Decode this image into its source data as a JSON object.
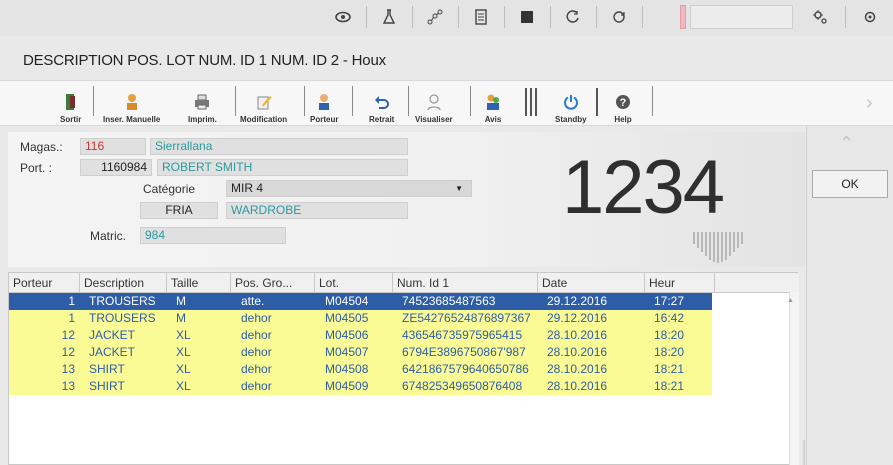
{
  "system_bar": {
    "icons": [
      "eye-icon",
      "flask-icon",
      "network-icon",
      "document-icon",
      "square-icon",
      "refresh-icon",
      "sync-icon",
      "gear-icon",
      "record-icon"
    ]
  },
  "window": {
    "title": "DESCRIPTION POS. LOT NUM. ID 1 NUM. ID 2 - Houx"
  },
  "toolbar": {
    "sortir": "Sortir",
    "inser_manuelle": "Inser. Manuelle",
    "imprim": "Imprim.",
    "modification": "Modification",
    "porteur": "Porteur",
    "retrait": "Retrait",
    "visualiser": "Visualiser",
    "avis": "Avis",
    "standby": "Standby",
    "help": "Help"
  },
  "form": {
    "magas_label": "Magas.:",
    "magas_code": "116",
    "magas_name": "Sierrallana",
    "port_label": "Port. :",
    "port_id": "1160984",
    "port_name": "ROBERT SMITH",
    "categorie_label": "Catégorie",
    "categorie_value": "MIR 4",
    "fria": "FRIA",
    "wardrobe": "WARDROBE",
    "matric_label": "Matric.",
    "matric_value": "984",
    "big_number": "1234"
  },
  "side": {
    "ok_label": "OK"
  },
  "table": {
    "columns": [
      "Porteur",
      "Description",
      "Taille",
      "Pos. Gro...",
      "Lot.",
      "Num. Id 1",
      "Date",
      "Heur"
    ],
    "rows": [
      [
        "1",
        "TROUSERS",
        "M",
        "atte.",
        "M04504",
        "74523685487563",
        "29.12.2016",
        "17:27"
      ],
      [
        "1",
        "TROUSERS",
        "M",
        "dehor",
        "M04505",
        "ZE54276524876897367",
        "29.12.2016",
        "16:42"
      ],
      [
        "12",
        "JACKET",
        "XL",
        "dehor",
        "M04506",
        "436546735975965415",
        "28.10.2016",
        "18:20"
      ],
      [
        "12",
        "JACKET",
        "XL",
        "dehor",
        "M04507",
        "6794E3896750867'987",
        "28.10.2016",
        "18:20"
      ],
      [
        "13",
        "SHIRT",
        "XL",
        "dehor",
        "M04508",
        "6421867579640650786",
        "28.10.2016",
        "18:21"
      ],
      [
        "13",
        "SHIRT",
        "XL",
        "dehor",
        "M04509",
        "674825349650876408",
        "28.10.2016",
        "18:21"
      ]
    ]
  },
  "colors": {
    "selection": "#2d5da6",
    "highlight": "#fbfb96",
    "code_red": "#d0312d",
    "name_teal": "#2a9aa0"
  }
}
